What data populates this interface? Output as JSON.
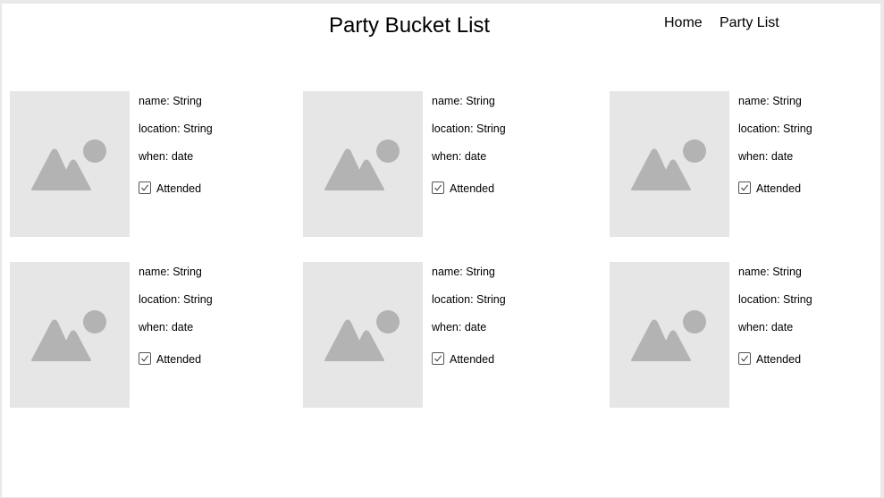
{
  "header": {
    "title": "Party Bucket List",
    "nav": {
      "home_label": "Home",
      "party_list_label": "Party List"
    }
  },
  "colors": {
    "placeholder_bg": "#e6e6e6",
    "placeholder_icon": "#b3b3b3"
  },
  "cards": [
    {
      "name": "name: String",
      "location": "location: String",
      "when": "when: date",
      "attended_label": "Attended",
      "attended": true,
      "image_icon": "image-placeholder-icon"
    },
    {
      "name": "name: String",
      "location": "location: String",
      "when": "when: date",
      "attended_label": "Attended",
      "attended": true,
      "image_icon": "image-placeholder-icon"
    },
    {
      "name": "name: String",
      "location": "location: String",
      "when": "when: date",
      "attended_label": "Attended",
      "attended": true,
      "image_icon": "image-placeholder-icon"
    },
    {
      "name": "name: String",
      "location": "location: String",
      "when": "when: date",
      "attended_label": "Attended",
      "attended": true,
      "image_icon": "image-placeholder-icon"
    },
    {
      "name": "name: String",
      "location": "location: String",
      "when": "when: date",
      "attended_label": "Attended",
      "attended": true,
      "image_icon": "image-placeholder-icon"
    },
    {
      "name": "name: String",
      "location": "location: String",
      "when": "when: date",
      "attended_label": "Attended",
      "attended": true,
      "image_icon": "image-placeholder-icon"
    }
  ]
}
